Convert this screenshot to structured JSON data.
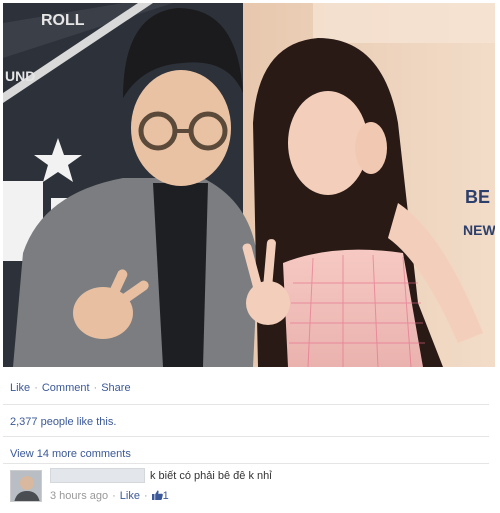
{
  "photo": {
    "signage": [
      "ROLL",
      "UND",
      "BE",
      "NEW"
    ]
  },
  "post_actions": {
    "like": "Like",
    "comment": "Comment",
    "share": "Share",
    "separator": "·"
  },
  "likes_summary": "2,377 people like this.",
  "view_more_comments": "View 14 more comments",
  "comments": [
    {
      "text": "k biết có phải bê đê k nhỉ",
      "time": "3 hours ago",
      "like_label": "Like",
      "like_count": "1",
      "separator": "·"
    }
  ],
  "colors": {
    "link": "#3b5998",
    "meta": "#999999",
    "divider": "#e5e5e5"
  }
}
